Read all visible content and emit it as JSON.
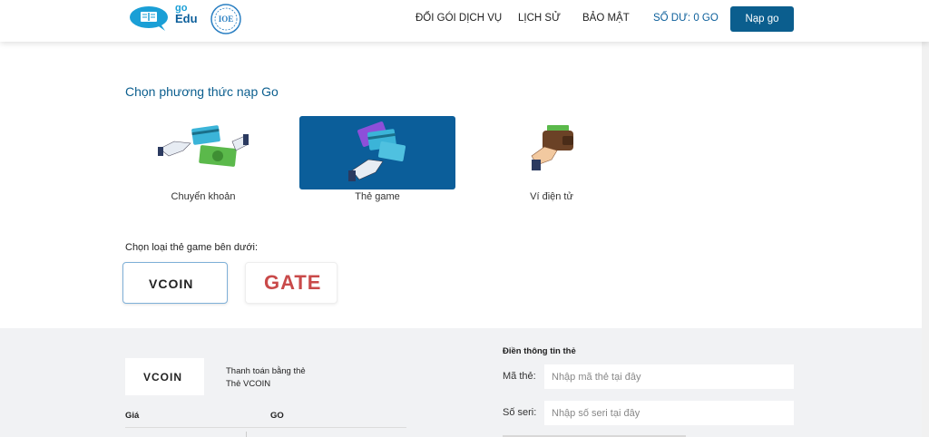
{
  "header": {
    "brand_go": "go",
    "brand_edu": "Edu",
    "ioe_logo_text": "IOE",
    "nav": [
      {
        "label": "ĐỔI GÓI DỊCH VỤ"
      },
      {
        "label": "LỊCH SỬ"
      },
      {
        "label": "BẢO MẬT"
      },
      {
        "label": "SỐ DƯ: 0 GO"
      }
    ],
    "cta_label": "Nạp go",
    "accent_color": "#0b5e8e"
  },
  "methods": {
    "title": "Chọn phương thức nạp Go",
    "items": [
      {
        "label": "Chuyển khoản",
        "icon": "bank-transfer-icon",
        "selected": false
      },
      {
        "label": "Thẻ game",
        "icon": "game-card-icon",
        "selected": true
      },
      {
        "label": "Ví điện tử",
        "icon": "e-wallet-icon",
        "selected": false
      }
    ]
  },
  "card_types": {
    "title": "Chọn loại thẻ game bên dưới:",
    "items": [
      {
        "logo_text": "VCOIN",
        "selected": true
      },
      {
        "logo_text": "GATE",
        "selected": false
      }
    ]
  },
  "summary": {
    "logo_text": "VCOIN",
    "pay_line1": "Thanh toán bằng thẻ",
    "pay_line2": "Thẻ VCOIN",
    "col_price": "Giá",
    "col_go": "GO"
  },
  "form": {
    "title": "Điền thông tin thẻ",
    "card_code_label": "Mã thẻ:",
    "card_code_placeholder": "Nhập mã thẻ tại đây",
    "serial_label": "Số seri:",
    "serial_placeholder": "Nhập số seri tại đây"
  }
}
